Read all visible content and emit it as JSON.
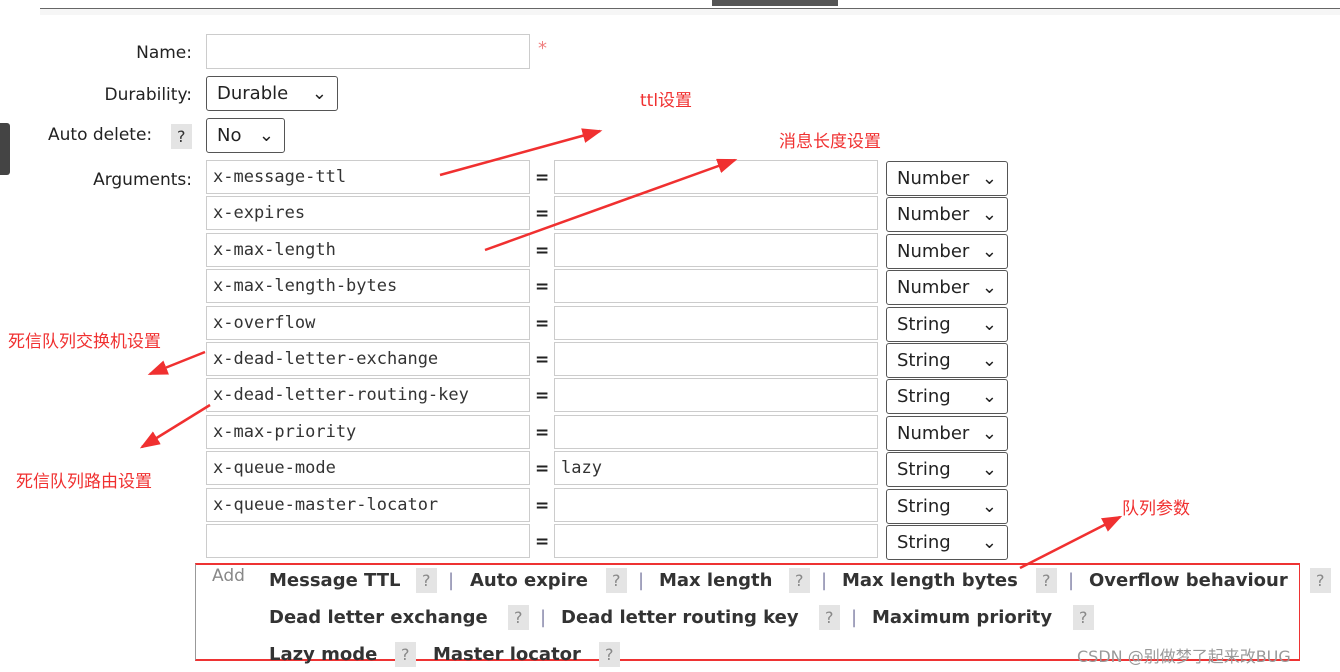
{
  "form": {
    "name_label": "Name:",
    "name_value": "",
    "required_mark": "*",
    "durability_label": "Durability:",
    "durability_value": "Durable",
    "auto_delete_label": "Auto delete:",
    "auto_delete_help": "?",
    "auto_delete_value": "No",
    "arguments_label": "Arguments:",
    "equals": "=",
    "arguments": [
      {
        "key": "x-message-ttl",
        "value": "",
        "type": "Number"
      },
      {
        "key": "x-expires",
        "value": "",
        "type": "Number"
      },
      {
        "key": "x-max-length",
        "value": "",
        "type": "Number"
      },
      {
        "key": "x-max-length-bytes",
        "value": "",
        "type": "Number"
      },
      {
        "key": "x-overflow",
        "value": "",
        "type": "String"
      },
      {
        "key": "x-dead-letter-exchange",
        "value": "",
        "type": "String"
      },
      {
        "key": "x-dead-letter-routing-key",
        "value": "",
        "type": "String"
      },
      {
        "key": "x-max-priority",
        "value": "",
        "type": "Number"
      },
      {
        "key": "x-queue-mode",
        "value": "lazy",
        "type": "String"
      },
      {
        "key": "x-queue-master-locator",
        "value": "",
        "type": "String"
      },
      {
        "key": "",
        "value": "",
        "type": "String"
      }
    ]
  },
  "add": {
    "label": "Add",
    "help": "?",
    "sep": "|",
    "links": [
      "Message TTL",
      "Auto expire",
      "Max length",
      "Max length bytes",
      "Overflow behaviour",
      "Dead letter exchange",
      "Dead letter routing key",
      "Maximum priority",
      "Lazy mode",
      "Master locator"
    ]
  },
  "annotations": {
    "ttl": "ttl设置",
    "length": "消息长度设置",
    "dlx": "死信队列交换机设置",
    "dlrk": "死信队列路由设置",
    "args": "队列参数",
    "color": "#f03030"
  },
  "watermark": "CSDN @别做梦了起来改BUG"
}
